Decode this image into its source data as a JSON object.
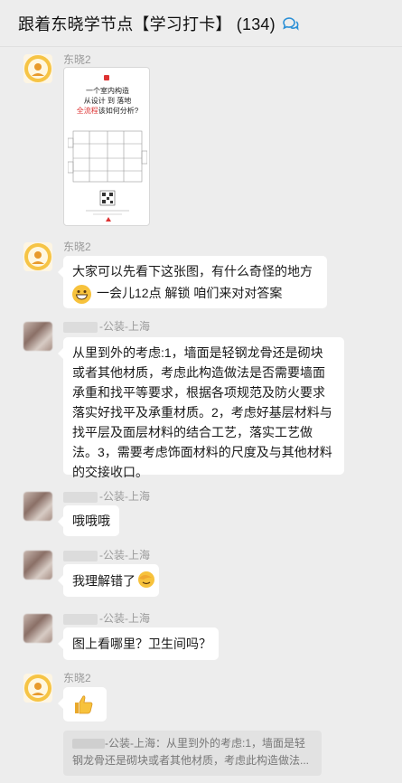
{
  "header": {
    "title": "跟着东晓学节点【学习打卡】 (134)"
  },
  "messages": [
    {
      "sender": "东晓2",
      "type": "image",
      "image_lines": [
        "一个室内构造",
        "从设计 到 落地",
        "全流程",
        "该如何分析?"
      ]
    },
    {
      "sender": "东晓2",
      "line1": "大家可以先看下这张图，有什么奇怪的地方",
      "line2": "一会儿12点 解锁  咱们来对对答案"
    },
    {
      "sender": "-公装-上海",
      "text": "从里到外的考虑:1，墙面是轻钢龙骨还是砌块或者其他材质，考虑此构造做法是否需要墙面承重和找平等要求，根据各项规范及防火要求落实好找平及承重材质。2，考虑好基层材料与找平层及面层材料的结合工艺，落实工艺做法。3，需要考虑饰面材料的尺度及与其他材料的交接收口。"
    },
    {
      "sender": "-公装-上海",
      "text": "哦哦哦"
    },
    {
      "sender": "-公装-上海",
      "text": "我理解错了"
    },
    {
      "sender": "-公装-上海",
      "text": "图上看哪里？卫生间吗？"
    },
    {
      "sender": "东晓2",
      "type": "emoji",
      "emoji": "thumbs-up"
    }
  ],
  "quote": {
    "sender": "-公装-上海：",
    "text": "从里到外的考虑:1，墙面是轻钢龙骨还是砌块或者其他材质，考虑此构造做法..."
  }
}
